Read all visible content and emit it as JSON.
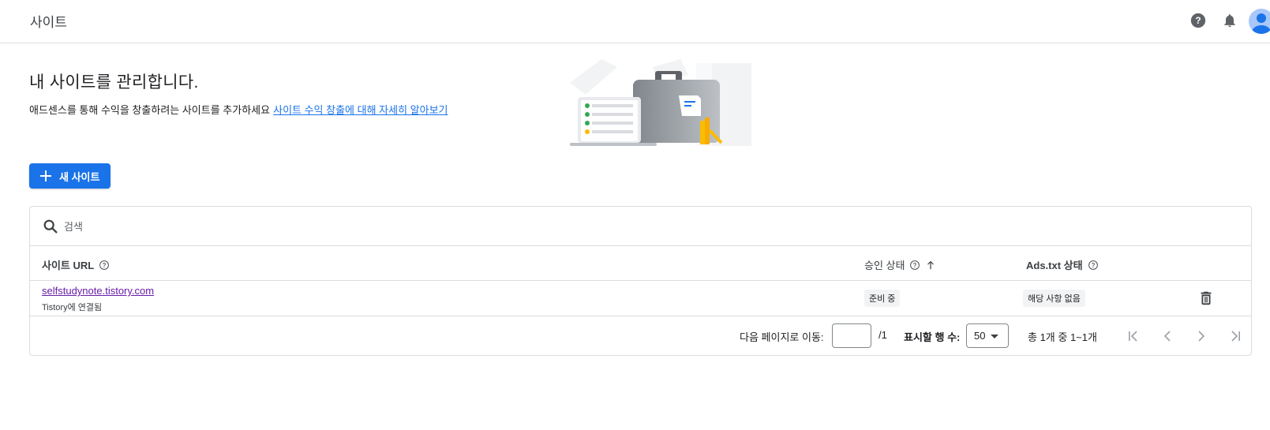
{
  "header": {
    "title": "사이트",
    "icons": [
      "help-icon",
      "notifications-icon",
      "avatar"
    ]
  },
  "intro": {
    "heading": "내 사이트를 관리합니다.",
    "description": "애드센스를 통해 수익을 창출하려는 사이트를 추가하세요",
    "learn_more_link": "사이트 수익 창출에 대해 자세히 알아보기"
  },
  "actions": {
    "new_site_label": "새 사이트"
  },
  "table": {
    "search_placeholder": "검색",
    "columns": {
      "url": "사이트 URL",
      "approval": "승인 상태",
      "ads_txt": "Ads.txt 상태"
    },
    "rows": [
      {
        "url": "selfstudynote.tistory.com",
        "subtext": "Tistory에 연결됨",
        "approval_status": "준비 중",
        "ads_txt_status": "해당 사항 없음"
      }
    ]
  },
  "pagination": {
    "goto_label": "다음 페이지로 이동:",
    "goto_value": "",
    "total_pages": "/1",
    "rows_label": "표시할 행 수:",
    "rows_value": "50",
    "range_text": "총 1개 중 1~1개"
  },
  "colors": {
    "primary": "#1a73e8",
    "visited_link": "#681da8",
    "border": "#dadce0",
    "chip_bg": "#f1f3f4"
  }
}
